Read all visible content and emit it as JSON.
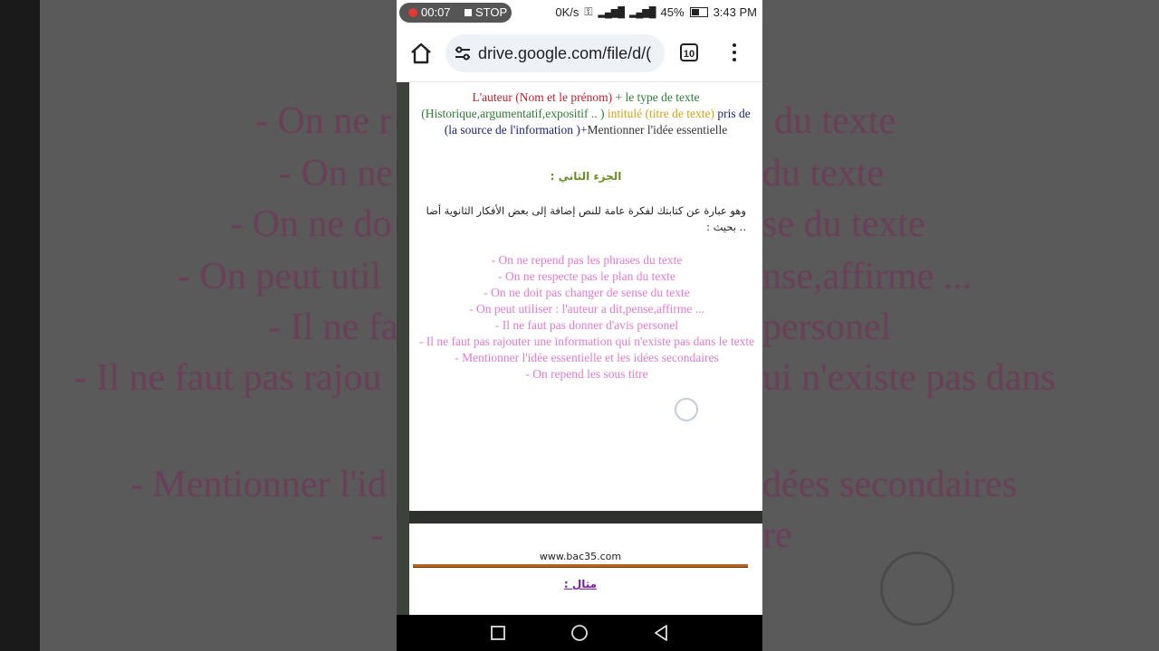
{
  "background": {
    "lines": [
      "- On ne r",
      "du texte",
      "- On ne",
      "du texte",
      "- On ne do",
      "se du texte",
      "- On peut util",
      "nse,affirme ...",
      "- Il ne fa",
      "personel",
      "- Il ne faut pas rajou",
      "ui n'existe pas dans",
      "- Mentionner l'id",
      "dées secondaires",
      "-",
      "re"
    ]
  },
  "status_bar": {
    "rec_time": "00:07",
    "stop_label": "STOP",
    "net_speed": "0K/s",
    "battery": "45%",
    "time": "3:43 PM"
  },
  "browser": {
    "url": "drive.google.com/file/d/(",
    "tab_count": "10"
  },
  "document": {
    "intro": {
      "author": "L'auteur (Nom et le prénom)",
      "plus_type": "+ le type de texte (Historique,argumentatif,expositif .. )",
      "titled": "intitulé (titre de texte)",
      "source": "pris de (la source de l'information )",
      "main_idea": "+Mentionner l'idée essentielle"
    },
    "part_two_heading": "الجزء الثاني :",
    "part_two_text": "وهو عبارة عن كتابتك لفكرة عامة للنص إضافة إلى بعض الأفكار الثانوية أضا .. بحيث :",
    "rules": [
      "- On ne repend pas les phrases du texte",
      "- On ne respecte pas le plan du texte",
      "- On ne doit pas changer de sense du texte",
      "- On peut utiliser : l'auteur a dit,pense,affirme ...",
      "- Il ne faut pas donner d'avis personel",
      "- Il ne faut pas rajouter une information qui n'existe pas dans le texte",
      "- Mentionner l'idée essentielle et les idées secondaires",
      "- On repend les sous titre"
    ],
    "site": "www.bac35.com",
    "example_heading": "مثال :"
  },
  "colors": {
    "rules_pink": "#e07bd0",
    "author_red": "#c0202c",
    "type_green": "#2e7d32",
    "title_gold": "#d4a017",
    "source_navy": "#1a237e"
  }
}
